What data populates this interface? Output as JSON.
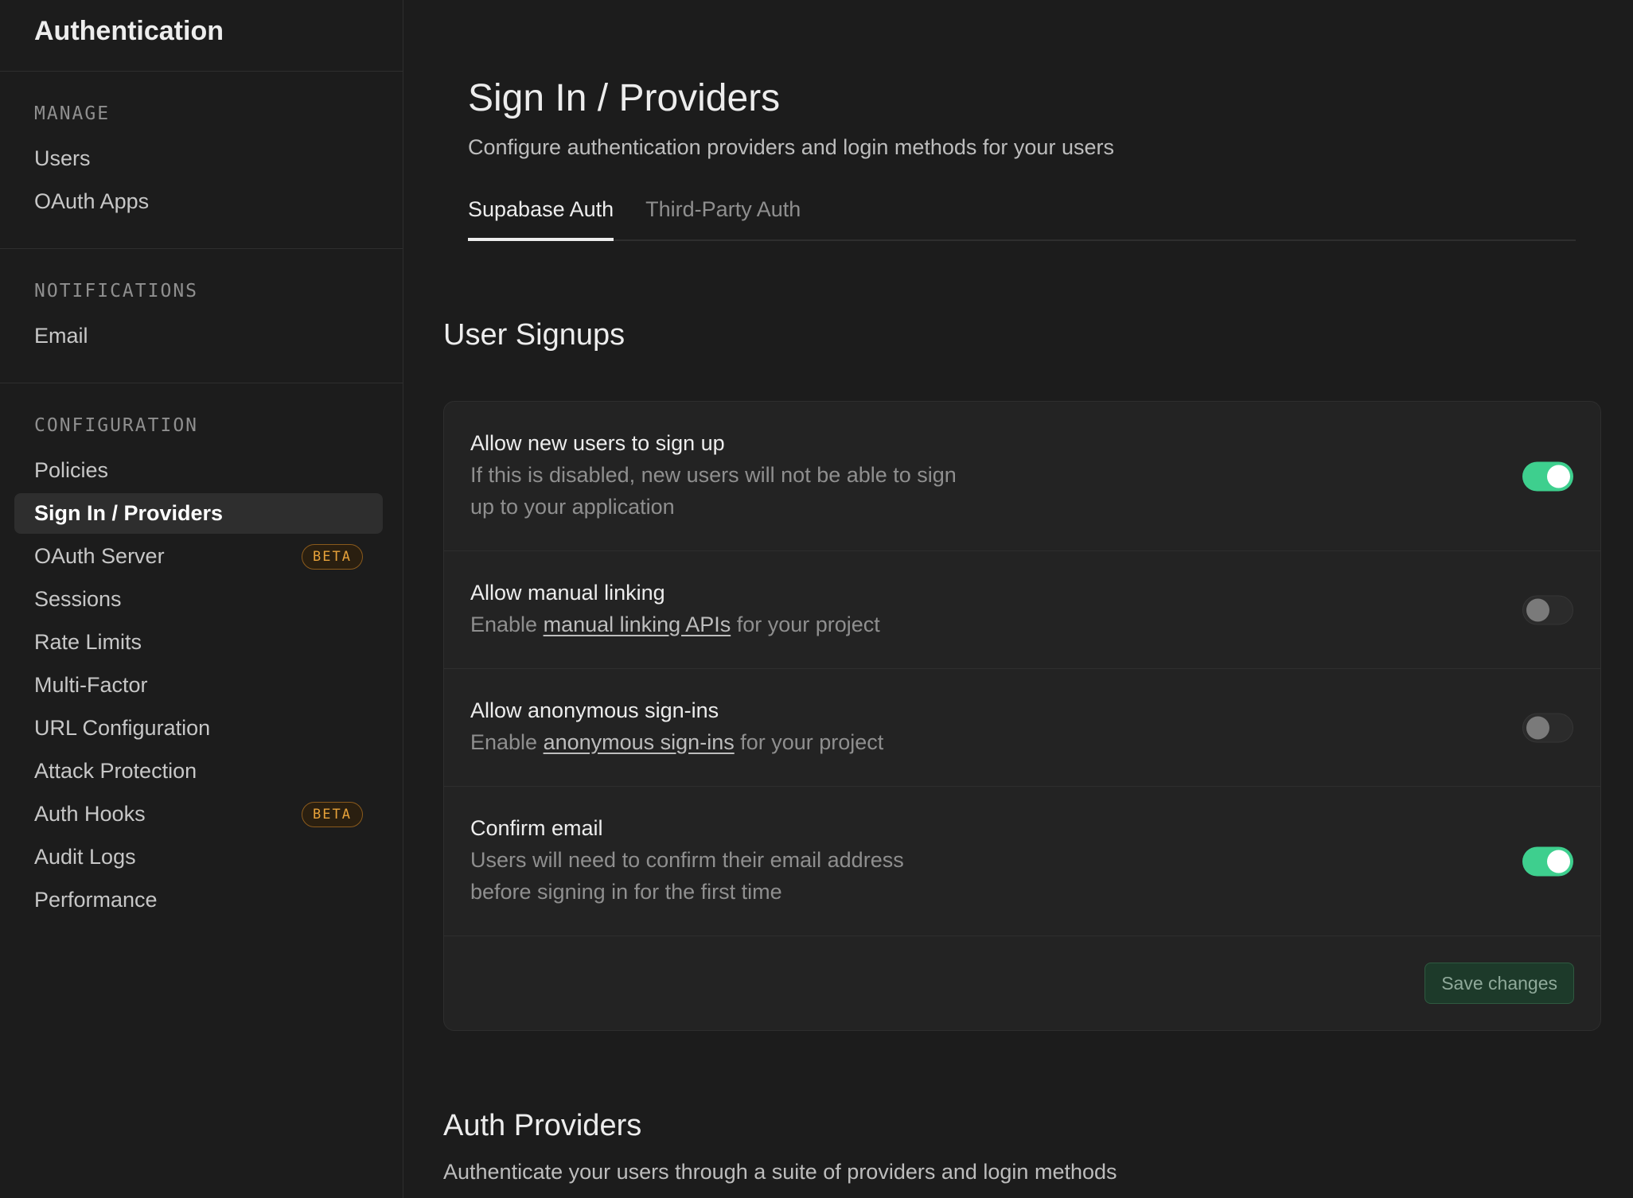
{
  "sidebar": {
    "title": "Authentication",
    "sections": [
      {
        "label": "MANAGE",
        "items": [
          "Users",
          "OAuth Apps"
        ]
      },
      {
        "label": "NOTIFICATIONS",
        "items": [
          "Email"
        ]
      },
      {
        "label": "CONFIGURATION",
        "items": [
          "Policies",
          "Sign In / Providers",
          "OAuth Server",
          "Sessions",
          "Rate Limits",
          "Multi-Factor",
          "URL Configuration",
          "Attack Protection",
          "Auth Hooks",
          "Audit Logs",
          "Performance"
        ]
      }
    ],
    "active_item": "Sign In / Providers",
    "beta_label": "BETA",
    "beta_items": [
      "OAuth Server",
      "Auth Hooks"
    ]
  },
  "page": {
    "title": "Sign In / Providers",
    "subtitle": "Configure authentication providers and login methods for your users"
  },
  "tabs": [
    {
      "label": "Supabase Auth",
      "active": true
    },
    {
      "label": "Third-Party Auth",
      "active": false
    }
  ],
  "user_signups": {
    "heading": "User Signups",
    "rows": {
      "signup": {
        "title": "Allow new users to sign up",
        "desc_line1": "If this is disabled, new users will not be able to sign",
        "desc_line2": "up to your application",
        "enabled": true
      },
      "manual_linking": {
        "title": "Allow manual linking",
        "desc_prefix": "Enable ",
        "desc_link": "manual linking APIs",
        "desc_suffix": " for your project",
        "enabled": false
      },
      "anonymous": {
        "title": "Allow anonymous sign-ins",
        "desc_prefix": "Enable ",
        "desc_link": "anonymous sign-ins",
        "desc_suffix": " for your project",
        "enabled": false
      },
      "confirm_email": {
        "title": "Confirm email",
        "desc_line1": "Users will need to confirm their email address",
        "desc_line2": "before signing in for the first time",
        "enabled": true
      }
    },
    "save_label": "Save changes"
  },
  "auth_providers": {
    "heading": "Auth Providers",
    "description": "Authenticate your users through a suite of providers and login methods"
  },
  "colors": {
    "background": "#1c1c1c",
    "card": "#232323",
    "accent_green": "#3ecf8e",
    "beta": "#e7a23a"
  }
}
